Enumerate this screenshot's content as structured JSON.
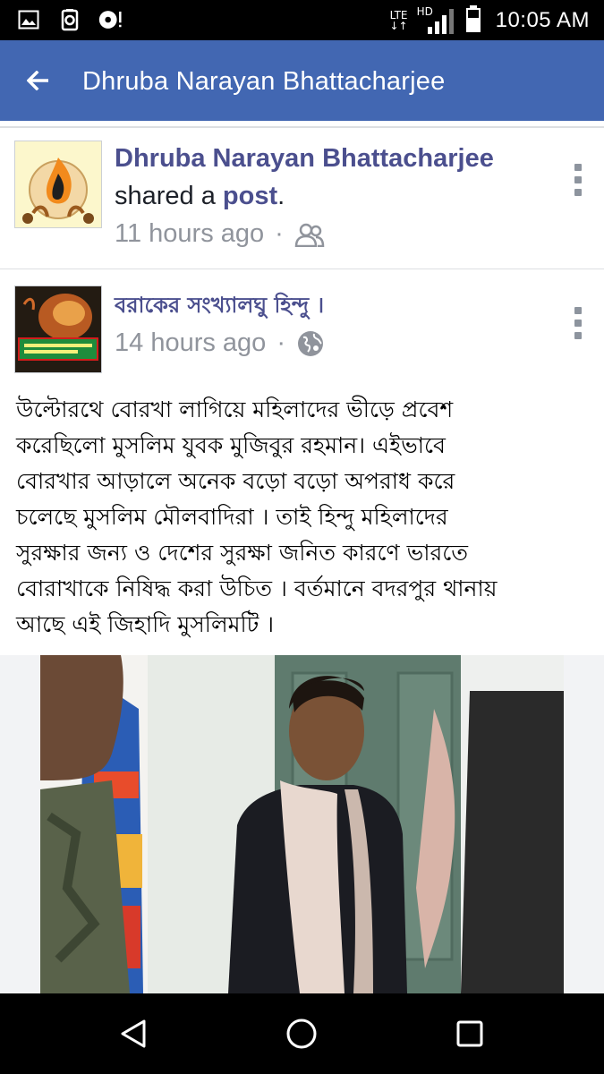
{
  "status_bar": {
    "network_type": "LTE",
    "signal_label": "HD",
    "time": "10:05 AM",
    "icons": [
      "gallery-icon",
      "recycle-icon",
      "sync-alert-icon",
      "lte-data-icon",
      "signal-icon",
      "battery-icon"
    ]
  },
  "app_bar": {
    "title": "Dhruba Narayan Bhattacharjee",
    "back_icon": "arrow-left-icon",
    "color": "#4267b2"
  },
  "share_story": {
    "author": "Dhruba Narayan Bhattacharjee",
    "action_prefix": "shared a ",
    "action_link": "post",
    "action_suffix": ".",
    "time": "11 hours ago",
    "separator": "·",
    "audience_icon": "friends-icon"
  },
  "original_post": {
    "page_name": "বরাকের সংখ্যালঘু হিন্দু",
    "page_name_suffix": "।",
    "time": "14 hours ago",
    "separator": "·",
    "audience_icon": "globe-icon",
    "text_lines": [
      "উল্টোরথে বোরখা লাগিয়ে মহিলাদের ভীড়ে প্রবেশ",
      "করেছিলো মুসলিম যুবক মুজিবুর রহমান। এইভাবে",
      "বোরখার আড়ালে অনেক বড়ো বড়ো অপরাধ করে",
      "চলেছে মুসলিম মৌলবাদিরা । তাই হিন্দু মহিলাদের",
      "সুরক্ষার জন্য ও দেশের সুরক্ষা জনিত কারণে ভারতে",
      "বোরাখাকে নিষিদ্ধ করা উচিত । বর্তমানে বদরপুর থানায়",
      "আছে এই জিহাদি মুসলিমটি ।"
    ]
  },
  "nav_bar": {
    "buttons": [
      "back-triangle-icon",
      "home-circle-icon",
      "recents-square-icon"
    ]
  }
}
